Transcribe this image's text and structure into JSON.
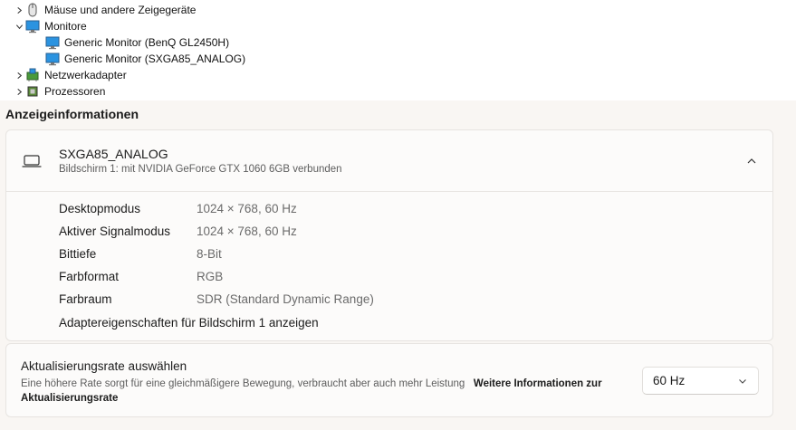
{
  "tree": {
    "items": [
      {
        "label": "Mäuse und andere Zeigegeräte",
        "expanded": false,
        "icon": "mouse-icon"
      },
      {
        "label": "Monitore",
        "expanded": true,
        "icon": "monitor-icon"
      },
      {
        "label": "Generic Monitor (BenQ GL2450H)",
        "icon": "monitor-icon"
      },
      {
        "label": "Generic Monitor (SXGA85_ANALOG)",
        "icon": "monitor-icon"
      },
      {
        "label": "Netzwerkadapter",
        "expanded": false,
        "icon": "network-adapter-icon"
      },
      {
        "label": "Prozessoren",
        "expanded": false,
        "icon": "processor-icon"
      }
    ]
  },
  "settings": {
    "section_title": "Anzeigeinformationen",
    "display": {
      "name": "SXGA85_ANALOG",
      "subtitle": "Bildschirm 1: mit NVIDIA GeForce GTX 1060 6GB verbunden",
      "icon": "laptop-icon"
    },
    "properties": [
      {
        "label": "Desktopmodus",
        "value": "1024 × 768, 60 Hz"
      },
      {
        "label": "Aktiver Signalmodus",
        "value": "1024 × 768, 60 Hz"
      },
      {
        "label": "Bittiefe",
        "value": "8-Bit"
      },
      {
        "label": "Farbformat",
        "value": "RGB"
      },
      {
        "label": "Farbraum",
        "value": "SDR (Standard Dynamic Range)"
      }
    ],
    "adapter_link": "Adaptereigenschaften für Bildschirm 1 anzeigen",
    "refresh": {
      "title": "Aktualisierungsrate auswählen",
      "description": "Eine höhere Rate sorgt für eine gleichmäßigere Bewegung, verbraucht aber auch mehr Leistung",
      "more_link": "Weitere Informationen zur Aktualisierungsrate",
      "selected": "60 Hz"
    }
  },
  "colors": {
    "background": "#f9f6f3",
    "card": "#fcfbfa",
    "monitor_blue": "#1e88d8"
  }
}
